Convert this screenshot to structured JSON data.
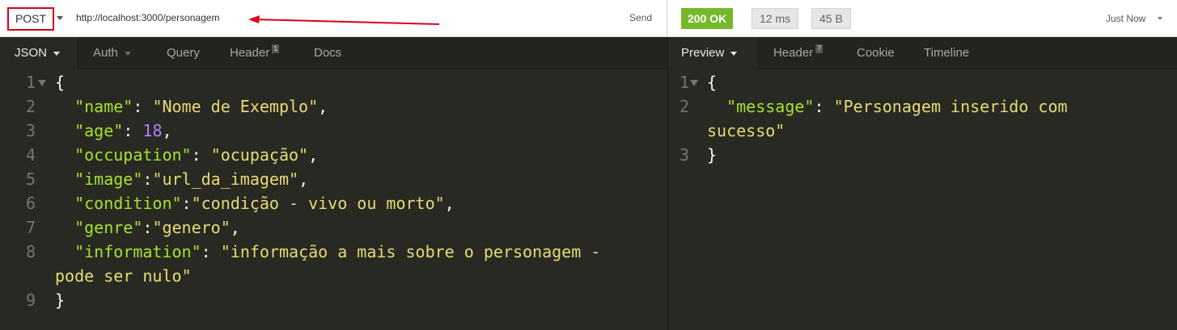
{
  "request": {
    "method": "POST",
    "url": "http://localhost:3000/personagem",
    "send_label": "Send",
    "annotation_color": "#d9001b"
  },
  "response": {
    "status": "200 OK",
    "time": "12 ms",
    "size": "45 B",
    "timestamp": "Just Now"
  },
  "request_tabs": [
    {
      "label": "JSON",
      "active": true
    },
    {
      "label": "Auth"
    },
    {
      "label": "Query"
    },
    {
      "label": "Header",
      "badge": "1"
    },
    {
      "label": "Docs"
    }
  ],
  "response_tabs": [
    {
      "label": "Preview",
      "active": true
    },
    {
      "label": "Header",
      "badge": "7"
    },
    {
      "label": "Cookie"
    },
    {
      "label": "Timeline"
    }
  ],
  "request_body": {
    "line_numbers": [
      "1",
      "2",
      "3",
      "4",
      "5",
      "6",
      "7",
      "8",
      "",
      "9"
    ],
    "lines": [
      "{",
      "  \"name\": \"Nome de Exemplo\",",
      "  \"age\": 18,",
      "  \"occupation\": \"ocupação\",",
      "  \"image\":\"url_da_imagem\",",
      "  \"condition\":\"condição - vivo ou morto\",",
      "  \"genre\":\"genero\",",
      "  \"information\": \"informação a mais sobre o personagem -",
      "pode ser nulo\"",
      "}"
    ]
  },
  "response_body": {
    "line_numbers": [
      "1",
      "2",
      "",
      "3"
    ],
    "lines": [
      "{",
      "  \"message\": \"Personagem inserido com",
      "sucesso\"",
      "}"
    ]
  },
  "colors": {
    "status_ok": "#75b92a",
    "editor_bg": "#282923",
    "json_key": "#a6e22e",
    "json_string": "#e6db74",
    "json_number": "#ae81ff"
  }
}
